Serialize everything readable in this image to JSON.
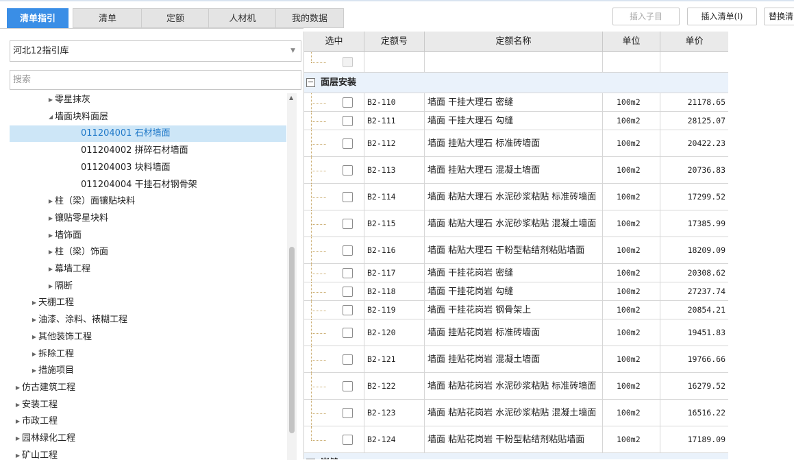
{
  "tabs": [
    {
      "label": "清单指引",
      "active": true
    },
    {
      "label": "清单",
      "active": false
    },
    {
      "label": "定额",
      "active": false
    },
    {
      "label": "人材机",
      "active": false
    },
    {
      "label": "我的数据",
      "active": false
    }
  ],
  "toolbar": {
    "insert_child": "插入子目",
    "insert_list": "插入清单(I)",
    "replace": "替换清"
  },
  "library_select": {
    "value": "河北12指引库"
  },
  "search": {
    "placeholder": "搜索",
    "value": ""
  },
  "tree": [
    {
      "label": "零星抹灰",
      "arrow": "collapsed",
      "level": 2,
      "selected": false
    },
    {
      "label": "墙面块料面层",
      "arrow": "expanded",
      "level": 2,
      "selected": false
    },
    {
      "label": "011204001  石材墙面",
      "arrow": "none",
      "level": 3,
      "selected": true
    },
    {
      "label": "011204002  拼碎石材墙面",
      "arrow": "none",
      "level": 3,
      "selected": false
    },
    {
      "label": "011204003  块料墙面",
      "arrow": "none",
      "level": 3,
      "selected": false
    },
    {
      "label": "011204004  干挂石材钢骨架",
      "arrow": "none",
      "level": 3,
      "selected": false
    },
    {
      "label": "柱（梁）面镶贴块料",
      "arrow": "collapsed",
      "level": 2,
      "selected": false
    },
    {
      "label": "镶贴零星块料",
      "arrow": "collapsed",
      "level": 2,
      "selected": false
    },
    {
      "label": "墙饰面",
      "arrow": "collapsed",
      "level": 2,
      "selected": false
    },
    {
      "label": "柱（梁）饰面",
      "arrow": "collapsed",
      "level": 2,
      "selected": false
    },
    {
      "label": "幕墙工程",
      "arrow": "collapsed",
      "level": 2,
      "selected": false
    },
    {
      "label": "隔断",
      "arrow": "collapsed",
      "level": 2,
      "selected": false
    },
    {
      "label": "天棚工程",
      "arrow": "collapsed",
      "level": 1,
      "selected": false
    },
    {
      "label": "油漆、涂料、裱糊工程",
      "arrow": "collapsed",
      "level": 1,
      "selected": false
    },
    {
      "label": "其他装饰工程",
      "arrow": "collapsed",
      "level": 1,
      "selected": false
    },
    {
      "label": "拆除工程",
      "arrow": "collapsed",
      "level": 1,
      "selected": false
    },
    {
      "label": "措施项目",
      "arrow": "collapsed",
      "level": 1,
      "selected": false
    },
    {
      "label": "仿古建筑工程",
      "arrow": "collapsed",
      "level": 0,
      "selected": false
    },
    {
      "label": "安装工程",
      "arrow": "collapsed",
      "level": 0,
      "selected": false
    },
    {
      "label": "市政工程",
      "arrow": "collapsed",
      "level": 0,
      "selected": false
    },
    {
      "label": "园林绿化工程",
      "arrow": "collapsed",
      "level": 0,
      "selected": false
    },
    {
      "label": "矿山工程",
      "arrow": "collapsed",
      "level": 0,
      "selected": false
    }
  ],
  "grid": {
    "headers": [
      "选中",
      "定额号",
      "定额名称",
      "单位",
      "单价"
    ],
    "groups": [
      {
        "label": "面层安装",
        "rows": [
          {
            "code": "B2-110",
            "name": "墙面 干挂大理石 密缝",
            "unit": "100m2",
            "price": "21178.65",
            "checked": false
          },
          {
            "code": "B2-111",
            "name": "墙面 干挂大理石 勾缝",
            "unit": "100m2",
            "price": "28125.07",
            "checked": false
          },
          {
            "code": "B2-112",
            "name": "墙面 挂贴大理石 标准砖墙面",
            "unit": "100m2",
            "price": "20422.23",
            "checked": false
          },
          {
            "code": "B2-113",
            "name": "墙面 挂贴大理石 混凝土墙面",
            "unit": "100m2",
            "price": "20736.83",
            "checked": false
          },
          {
            "code": "B2-114",
            "name": "墙面 粘贴大理石 水泥砂浆粘贴 标准砖墙面",
            "unit": "100m2",
            "price": "17299.52",
            "checked": false
          },
          {
            "code": "B2-115",
            "name": "墙面 粘贴大理石 水泥砂浆粘贴 混凝土墙面",
            "unit": "100m2",
            "price": "17385.99",
            "checked": false
          },
          {
            "code": "B2-116",
            "name": "墙面 粘贴大理石 干粉型粘结剂粘贴墙面",
            "unit": "100m2",
            "price": "18209.09",
            "checked": false
          },
          {
            "code": "B2-117",
            "name": "墙面 干挂花岗岩 密缝",
            "unit": "100m2",
            "price": "20308.62",
            "checked": false
          },
          {
            "code": "B2-118",
            "name": "墙面 干挂花岗岩 勾缝",
            "unit": "100m2",
            "price": "27237.74",
            "checked": false
          },
          {
            "code": "B2-119",
            "name": "墙面 干挂花岗岩 钢骨架上",
            "unit": "100m2",
            "price": "20854.21",
            "checked": false
          },
          {
            "code": "B2-120",
            "name": "墙面 挂贴花岗岩 标准砖墙面",
            "unit": "100m2",
            "price": "19451.83",
            "checked": false
          },
          {
            "code": "B2-121",
            "name": "墙面 挂贴花岗岩 混凝土墙面",
            "unit": "100m2",
            "price": "19766.66",
            "checked": false
          },
          {
            "code": "B2-122",
            "name": "墙面 粘贴花岗岩 水泥砂浆粘贴 标准砖墙面",
            "unit": "100m2",
            "price": "16279.52",
            "checked": false
          },
          {
            "code": "B2-123",
            "name": "墙面 粘贴花岗岩 水泥砂浆粘贴 混凝土墙面",
            "unit": "100m2",
            "price": "16516.22",
            "checked": false
          },
          {
            "code": "B2-124",
            "name": "墙面 粘贴花岗岩 干粉型粘结剂粘贴墙面",
            "unit": "100m2",
            "price": "17189.09",
            "checked": false
          }
        ]
      },
      {
        "label": "嵌缝",
        "rows": []
      }
    ]
  },
  "colors": {
    "accent": "#3a8ee6",
    "selected_row": "#cde6f7",
    "group_row": "#eaf2fb"
  }
}
